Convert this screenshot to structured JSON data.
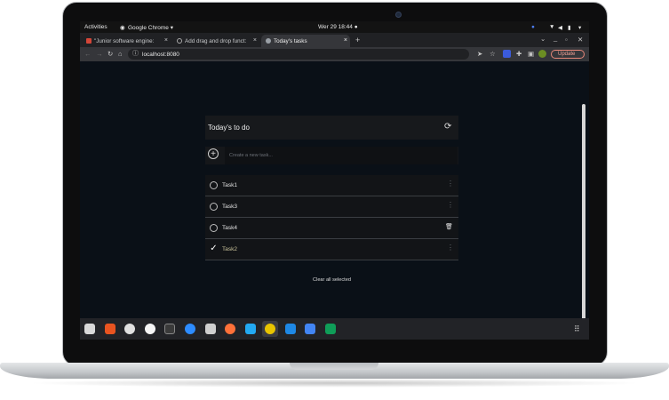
{
  "gnome": {
    "activities": "Activities",
    "app_menu": "Google Chrome ▾",
    "clock": "Wer 29  18:44  ●"
  },
  "tabs": [
    {
      "label": "\"Junior software engine:",
      "close": "×"
    },
    {
      "label": "Add drag and drop funct:",
      "close": "×"
    },
    {
      "label": "Today's tasks",
      "close": "×"
    }
  ],
  "new_tab": "+",
  "window_controls": {
    "chevron": "⌄",
    "minimize": "_",
    "maximize": "▫",
    "close": "✕"
  },
  "address": {
    "url": "localhost:8080",
    "update_label": "Update"
  },
  "todo": {
    "title": "Today's to do",
    "new_placeholder": "Create a new task...",
    "tasks": [
      {
        "label": "Task1",
        "done": false
      },
      {
        "label": "Task3",
        "done": false
      },
      {
        "label": "Task4",
        "done": false
      },
      {
        "label": "Task2",
        "done": true
      }
    ],
    "clear_label": "Clear all selected"
  },
  "icons": {
    "refresh": "⟳",
    "plus": "+",
    "check": "✓",
    "menu": "⋮",
    "trash": "🗑"
  },
  "dock_apps": [
    "files-icon",
    "software-icon",
    "disks-icon",
    "chromium-icon",
    "terminal-icon",
    "zoom-icon",
    "screenshot-icon",
    "firefox-icon",
    "vscode-icon",
    "chrome-icon",
    "kite-icon",
    "docs-icon",
    "sheets-icon"
  ]
}
